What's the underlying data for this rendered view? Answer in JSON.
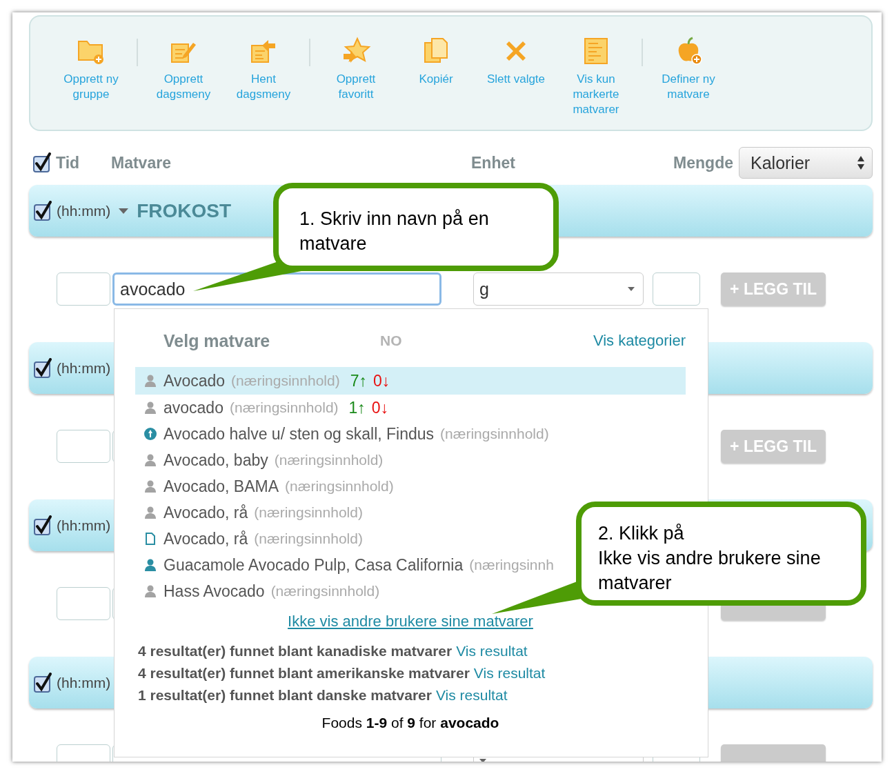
{
  "toolbar": {
    "groups": [
      [
        {
          "kind": "folder-add",
          "label": "Opprett ny gruppe"
        }
      ],
      [
        {
          "kind": "edit",
          "label": "Opprett dagsmeny"
        },
        {
          "kind": "fetch",
          "label": "Hent dagsmeny"
        }
      ],
      [
        {
          "kind": "favorite",
          "label": "Opprett favoritt"
        },
        {
          "kind": "copy",
          "label": "Kopiér"
        },
        {
          "kind": "delete",
          "label": "Slett valgte"
        },
        {
          "kind": "list",
          "label": "Vis kun markerte matvarer"
        }
      ],
      [
        {
          "kind": "apple-add",
          "label": "Definer ny matvare"
        }
      ]
    ]
  },
  "header": {
    "checked": true,
    "columns": [
      "Tid",
      "Matvare",
      "Enhet",
      "Mengde"
    ],
    "measure_select": {
      "value": "Kalorier"
    }
  },
  "meals": [
    {
      "checked": true,
      "time_placeholder": "(hh:mm)",
      "label": "FROKOST",
      "entry": {
        "food_value": "avocado",
        "focused": true,
        "unit": "g",
        "button": "+ LEGG TIL"
      }
    },
    {
      "checked": true,
      "time_placeholder": "(hh:mm)",
      "entry": {
        "button": "+ LEGG TIL"
      }
    },
    {
      "checked": true,
      "time_placeholder": "(hh:mm)"
    },
    {
      "checked": true,
      "time_placeholder": "(hh:mm)"
    }
  ],
  "dropdown": {
    "title": "Velg matvare",
    "language": "NO",
    "categories_link": "Vis kategorier",
    "items": [
      {
        "kind": "user",
        "name": "Avocado",
        "note": "(næringsinnhold)",
        "up": "7↑",
        "down": "0↓",
        "selected": true
      },
      {
        "kind": "user",
        "name": "avocado",
        "note": "(næringsinnhold)",
        "up": "1↑",
        "down": "0↓",
        "selected": false
      },
      {
        "kind": "verified",
        "name": "Avocado halve u/ sten og skall, Findus",
        "note": "(næringsinnhold)",
        "selected": false
      },
      {
        "kind": "user",
        "name": "Avocado, baby",
        "note": "(næringsinnhold)",
        "selected": false
      },
      {
        "kind": "user",
        "name": "Avocado, BAMA",
        "note": "(næringsinnhold)",
        "selected": false
      },
      {
        "kind": "user",
        "name": "Avocado, rå",
        "note": "(næringsinnhold)",
        "selected": false
      },
      {
        "kind": "document",
        "name": "Avocado, rå",
        "note": "(næringsinnhold)",
        "selected": false
      },
      {
        "kind": "shared",
        "name": "Guacamole Avocado Pulp, Casa California",
        "note": "(næringsinnh",
        "selected": false
      },
      {
        "kind": "user",
        "name": "Hass Avocado",
        "note": "(næringsinnhold)",
        "selected": false
      }
    ],
    "hide_others_link": "Ikke vis andre brukere sine matvarer",
    "other_results": [
      {
        "text": "4 resultat(er) funnet blant kanadiske matvarer",
        "link": "Vis resultat"
      },
      {
        "text": "4 resultat(er) funnet blant amerikanske matvarer",
        "link": "Vis resultat"
      },
      {
        "text": "1 resultat(er) funnet blant danske matvarer",
        "link": "Vis resultat"
      }
    ],
    "summary": "Foods **1-9** of **9** for **avocado**"
  },
  "callouts": [
    "1. Skriv inn navn på en matvare",
    "2. Klikk på\nIkke vis andre brukere sine\nmatvarer"
  ]
}
